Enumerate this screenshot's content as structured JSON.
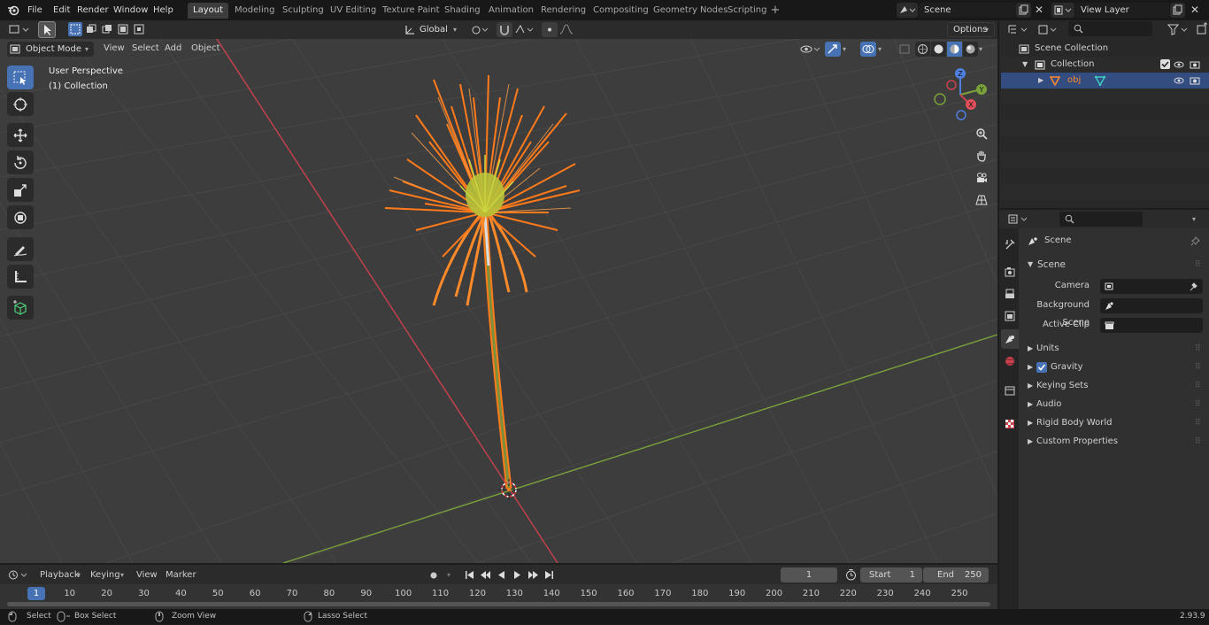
{
  "app": {
    "version": "2.93.9"
  },
  "menu": {
    "file": "File",
    "edit": "Edit",
    "render": "Render",
    "window": "Window",
    "help": "Help"
  },
  "workspaces": [
    "Layout",
    "Modeling",
    "Sculpting",
    "UV Editing",
    "Texture Paint",
    "Shading",
    "Animation",
    "Rendering",
    "Compositing",
    "Geometry Nodes",
    "Scripting"
  ],
  "scene": {
    "name": "Scene",
    "view_layer": "View Layer"
  },
  "viewport": {
    "mode": "Object Mode",
    "view": "View",
    "select": "Select",
    "add": "Add",
    "object": "Object",
    "transform_orientation": "Global",
    "options": "Options",
    "perspective": "User Perspective",
    "collection": "(1) Collection",
    "gizmo_labels": {
      "x": "X",
      "y": "Y",
      "z": "Z"
    }
  },
  "outliner": {
    "rows": [
      {
        "label": "Scene Collection"
      },
      {
        "label": "Collection"
      },
      {
        "label": "obj"
      }
    ]
  },
  "properties": {
    "header": "Scene",
    "panel": "Scene",
    "fields": [
      {
        "label": "Camera",
        "value": ""
      },
      {
        "label": "Background Scene",
        "value": ""
      },
      {
        "label": "Active Clip",
        "value": ""
      }
    ],
    "sections": [
      "Units",
      "Gravity",
      "Keying Sets",
      "Audio",
      "Rigid Body World",
      "Custom Properties"
    ]
  },
  "timeline": {
    "playback": "Playback",
    "keying": "Keying",
    "view": "View",
    "marker": "Marker",
    "current_frame": "1",
    "start_label": "Start",
    "start": "1",
    "end_label": "End",
    "end": "250",
    "ruler": [
      "1",
      "10",
      "20",
      "30",
      "40",
      "50",
      "60",
      "70",
      "80",
      "90",
      "100",
      "110",
      "120",
      "130",
      "140",
      "150",
      "160",
      "170",
      "180",
      "190",
      "200",
      "210",
      "220",
      "230",
      "240",
      "250"
    ]
  },
  "status": {
    "select": "Select",
    "box_select": "Box Select",
    "zoom_view": "Zoom View",
    "lasso_select": "Lasso Select"
  },
  "colors": {
    "accent": "#4772b3",
    "selected_orange": "#ff7a1a",
    "x_axis": "#c9414c",
    "y_axis": "#7aa13a",
    "grid_bg": "#3d3d3d"
  }
}
